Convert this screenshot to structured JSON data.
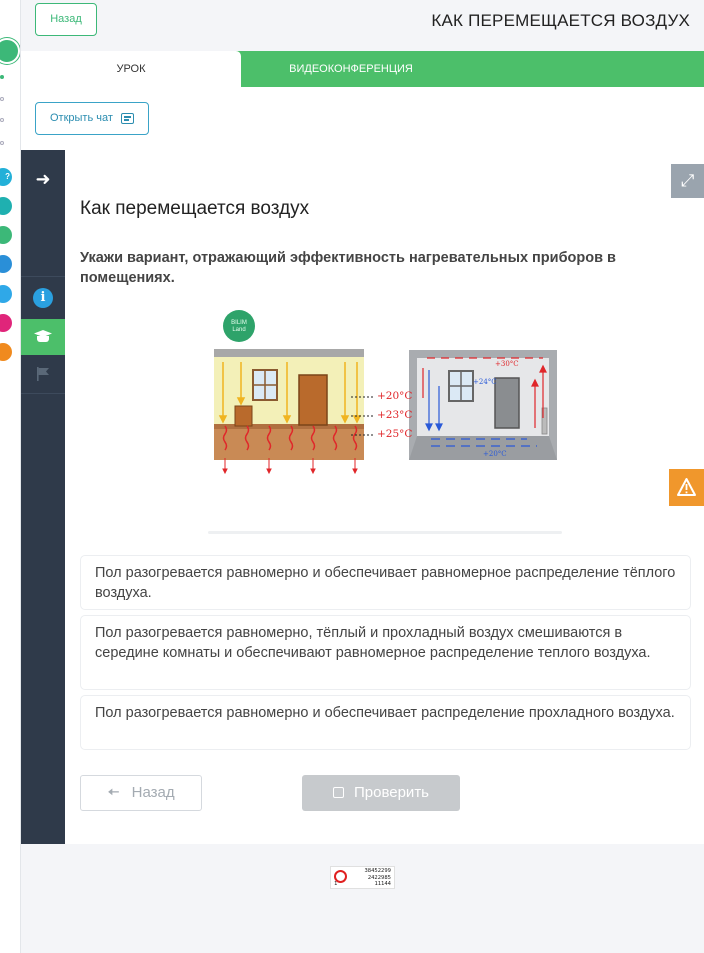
{
  "header": {
    "back_label": "Назад",
    "lesson_title": "КАК ПЕРЕМЕЩАЕТСЯ ВОЗДУХ"
  },
  "tabs": [
    {
      "label": "УРОК",
      "active": true
    },
    {
      "label": "ВИДЕОКОНФЕРЕНЦИЯ",
      "active": false
    }
  ],
  "chat": {
    "label": "Открыть чат"
  },
  "sidebar": {
    "icons": [
      "arrow-right-icon",
      "info-icon",
      "graduation-cap-icon",
      "flag-icon"
    ]
  },
  "content": {
    "heading": "Как перемещается воздух",
    "question": "Укажи вариант, отражающий эффективность нагревательных приборов в помещениях.",
    "illustration": {
      "logo": "BILIM Land",
      "left_temps": [
        "+20°C",
        "+23°C",
        "+25°C"
      ],
      "right_temps": [
        "+30°C",
        "+24°C",
        "+20°C"
      ]
    },
    "options": [
      "Пол разогревается равномерно и обеспечивает равномерное распределение тёплого воздуха.",
      "Пол разогревается равномерно, тёплый и прохладный воздух смешиваются в середине комнаты и обеспечивают равномерное распределение теплого воздуха.",
      "Пол разогревается равномерно и обеспечивает распределение прохладного воздуха."
    ],
    "buttons": {
      "back": "Назад",
      "check": "Проверить"
    }
  },
  "footer": {
    "counter_lines": [
      "38452299",
      "2422985",
      "11144"
    ],
    "counter_prefix": "1"
  },
  "colors": {
    "green": "#4cbf6a",
    "dark_sidebar": "#2f3a4a",
    "info_blue": "#2aa0e0",
    "warning_orange": "#f0972c"
  }
}
